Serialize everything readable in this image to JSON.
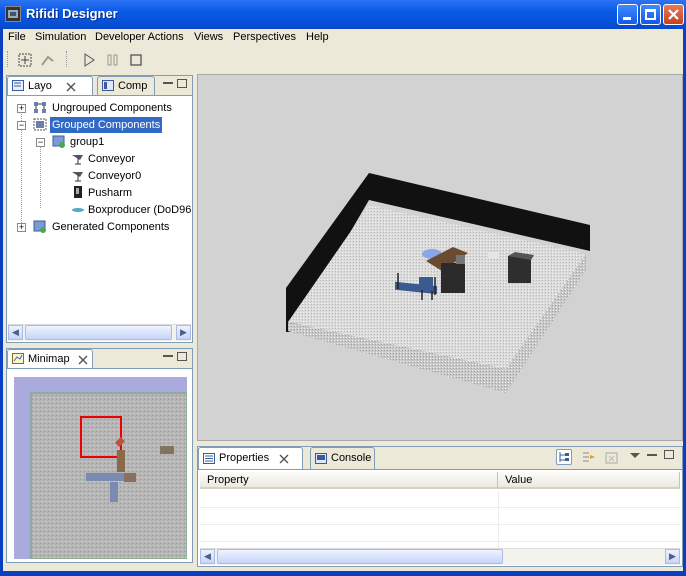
{
  "window": {
    "title": "Rifidi Designer"
  },
  "menubar": {
    "items": [
      "File",
      "Simulation",
      "Developer Actions",
      "Views",
      "Perspectives",
      "Help"
    ]
  },
  "toolbar": {
    "buttons": [
      "select-tool",
      "pan-tool",
      "play",
      "pause",
      "stop"
    ]
  },
  "layout_panel": {
    "tabs": [
      {
        "label": "Layo"
      },
      {
        "label": "Comp"
      }
    ],
    "tree": [
      {
        "label": "Ungrouped Components",
        "icon": "ungrouped-icon"
      },
      {
        "label": "Grouped Components",
        "icon": "grouped-icon",
        "selected": true
      },
      {
        "label": "group1",
        "icon": "group-icon"
      },
      {
        "label": "Conveyor",
        "icon": "conveyor-icon"
      },
      {
        "label": "Conveyor0",
        "icon": "conveyor-icon"
      },
      {
        "label": "Pusharm",
        "icon": "pusharm-icon"
      },
      {
        "label": "Boxproducer (DoD96",
        "icon": "boxproducer-icon"
      },
      {
        "label": "Generated Components",
        "icon": "generated-icon"
      }
    ]
  },
  "minimap_panel": {
    "tab": {
      "label": "Minimap"
    }
  },
  "properties_panel": {
    "tabs": [
      {
        "label": "Properties"
      },
      {
        "label": "Console"
      }
    ],
    "columns": [
      "Property",
      "Value"
    ]
  },
  "colors": {
    "selection": "#316ac5",
    "titlebar": "#0a5ae6",
    "view_bg": "#d2d2d2",
    "floor": "#d8d8d8"
  }
}
